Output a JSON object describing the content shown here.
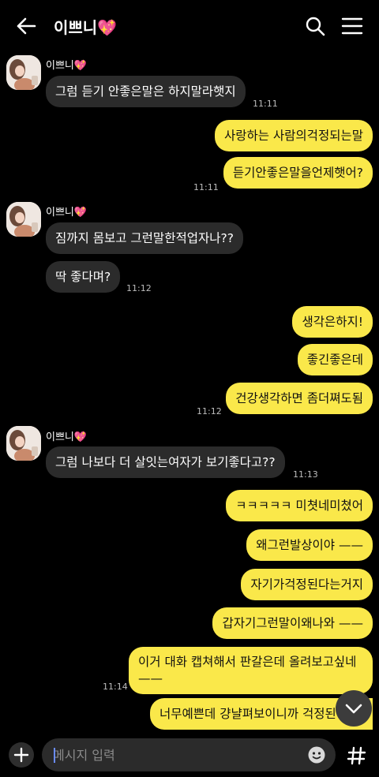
{
  "header": {
    "title": "이쁘니💖"
  },
  "messages": [
    {
      "sender": "이쁘니💖",
      "text": "그럼 듣기 안좋은말은 하지말라햇지",
      "time": "11:11"
    },
    {
      "text": "사랑하는 사람의걱정되는말"
    },
    {
      "text": "듣기안좋은말을언제햇어?",
      "time": "11:11"
    },
    {
      "sender": "이쁘니💖",
      "text": "짐까지 몸보고 그런말한적업자나??"
    },
    {
      "text": "딱 좋다며?",
      "time": "11:12"
    },
    {
      "text": "생각은하지!"
    },
    {
      "text": "좋긴좋은데"
    },
    {
      "text": "건강생각하면 좀더쪄도됨",
      "time": "11:12"
    },
    {
      "sender": "이쁘니💖",
      "text": "그럼 나보다 더 살잇는여자가 보기좋다고??",
      "time": "11:13"
    },
    {
      "text": "ㅋㅋㅋㅋㅋ 미쳣네미쳤어"
    },
    {
      "text": "왜그런발상이야 ——"
    },
    {
      "text": "자기가걱정된다는거지"
    },
    {
      "text": "갑자기그런말이왜나와 ——"
    },
    {
      "text_line1": "이거 대화 캡쳐해서 판갈은데 올려보고싶네",
      "text_line2": "——",
      "time": "11:14"
    },
    {
      "text": "너무예쁜데 걍냘펴보이니까 걱정된"
    }
  ],
  "input": {
    "placeholder": "메시지 입력"
  },
  "icons": {
    "back": "arrow-left-icon",
    "search": "search-icon",
    "menu": "hamburger-menu-icon",
    "add": "plus-icon",
    "emoji": "smiley-icon",
    "hashtag": "hashtag-icon",
    "scroll": "chevron-down-icon"
  },
  "colors": {
    "background": "#000000",
    "my_bubble": "#fae84a",
    "their_bubble": "#2b2b2b"
  }
}
